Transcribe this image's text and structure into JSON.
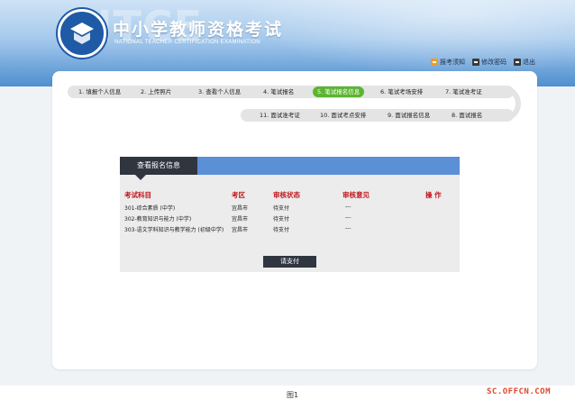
{
  "header": {
    "watermark": "NTCE",
    "title": "中小学教师资格考试",
    "subtitle": "NATIONAL TEACHER CERTIFICATION EXAMINATION"
  },
  "top_links": [
    {
      "label": "报考须知",
      "icon": "notice-icon"
    },
    {
      "label": "修改密码",
      "icon": "lock-icon"
    },
    {
      "label": "退出",
      "icon": "exit-icon"
    }
  ],
  "steps": [
    {
      "label": "1. 填报个人信息",
      "active": false
    },
    {
      "label": "2. 上传照片",
      "active": false
    },
    {
      "label": "3. 查看个人信息",
      "active": false
    },
    {
      "label": "4. 笔试报名",
      "active": false
    },
    {
      "label": "5. 笔试报名信息",
      "active": true
    },
    {
      "label": "6. 笔试考场安排",
      "active": false
    },
    {
      "label": "7. 笔试准考证",
      "active": false
    },
    {
      "label": "8. 面试报名",
      "active": false
    },
    {
      "label": "9. 面试报名信息",
      "active": false
    },
    {
      "label": "10. 面试考点安排",
      "active": false
    },
    {
      "label": "11. 面试准考证",
      "active": false
    }
  ],
  "info": {
    "tab_label": "查看报名信息",
    "columns": [
      "考试科目",
      "考区",
      "审核状态",
      "审核意见",
      "操 作"
    ],
    "rows": [
      {
        "subject": "301-综合素质 (中学)",
        "area": "宜昌市",
        "status": "待支付",
        "opinion": "---",
        "action": ""
      },
      {
        "subject": "302-教育知识与能力 (中学)",
        "area": "宜昌市",
        "status": "待支付",
        "opinion": "---",
        "action": ""
      },
      {
        "subject": "303-语文学科知识与教学能力 (初级中学)",
        "area": "宜昌市",
        "status": "待支付",
        "opinion": "---",
        "action": ""
      }
    ],
    "pay_label": "请支付"
  },
  "footer": {
    "caption": "图1",
    "watermark": "SC.OFFCN.COM"
  },
  "colors": {
    "active_step": "#5cb531",
    "header_blue": "#4f8fd0",
    "table_header_red": "#c0151b",
    "dark_button": "#2f3640"
  }
}
